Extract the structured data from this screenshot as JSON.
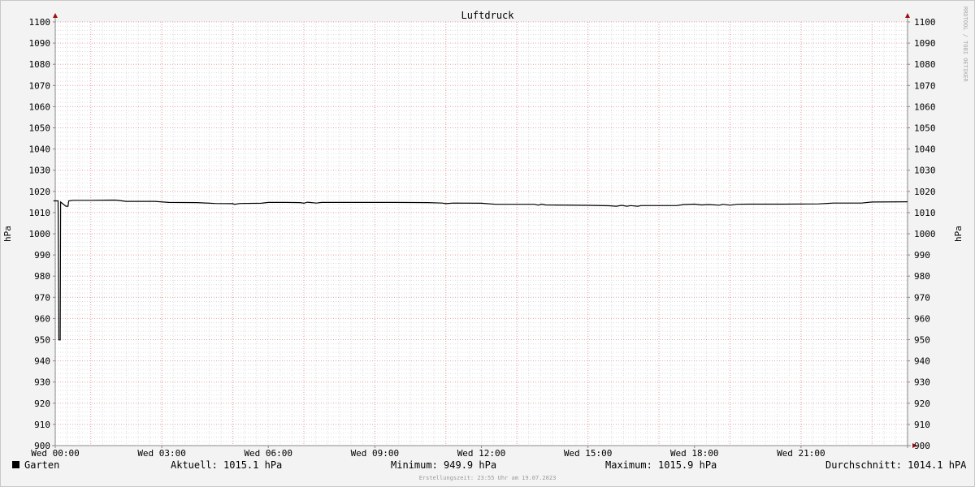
{
  "chart_data": {
    "type": "line",
    "title": "Luftdruck",
    "ylabel_left": "hPa",
    "ylabel_right": "hPa",
    "ylim": [
      900,
      1100
    ],
    "y_ticks": [
      900,
      910,
      920,
      930,
      940,
      950,
      960,
      970,
      980,
      990,
      1000,
      1010,
      1020,
      1030,
      1040,
      1050,
      1060,
      1070,
      1080,
      1090,
      1100
    ],
    "xlim_hours": [
      0,
      24
    ],
    "x_ticks": [
      {
        "hour": 0,
        "label": "Wed 00:00"
      },
      {
        "hour": 3,
        "label": "Wed 03:00"
      },
      {
        "hour": 6,
        "label": "Wed 06:00"
      },
      {
        "hour": 9,
        "label": "Wed 09:00"
      },
      {
        "hour": 12,
        "label": "Wed 12:00"
      },
      {
        "hour": 15,
        "label": "Wed 15:00"
      },
      {
        "hour": 18,
        "label": "Wed 18:00"
      },
      {
        "hour": 21,
        "label": "Wed 21:00"
      }
    ],
    "grid": true,
    "series": [
      {
        "name": "Garten",
        "color": "#000000",
        "points": [
          [
            -0.05,
            1015.5
          ],
          [
            0.08,
            1015.5
          ],
          [
            0.1,
            949.9
          ],
          [
            0.14,
            949.9
          ],
          [
            0.15,
            1015.0
          ],
          [
            0.3,
            1013.0
          ],
          [
            0.36,
            1013.0
          ],
          [
            0.38,
            1015.5
          ],
          [
            0.5,
            1015.8
          ],
          [
            1.0,
            1015.8
          ],
          [
            1.7,
            1015.9
          ],
          [
            2.0,
            1015.3
          ],
          [
            2.8,
            1015.3
          ],
          [
            3.2,
            1014.8
          ],
          [
            4.0,
            1014.7
          ],
          [
            4.5,
            1014.3
          ],
          [
            5.0,
            1014.2
          ],
          [
            5.05,
            1013.9
          ],
          [
            5.2,
            1014.3
          ],
          [
            5.8,
            1014.4
          ],
          [
            6.0,
            1014.8
          ],
          [
            6.5,
            1014.8
          ],
          [
            6.9,
            1014.7
          ],
          [
            7.0,
            1014.4
          ],
          [
            7.1,
            1014.9
          ],
          [
            7.35,
            1014.5
          ],
          [
            7.5,
            1014.8
          ],
          [
            8.5,
            1014.8
          ],
          [
            9.5,
            1014.8
          ],
          [
            10.5,
            1014.7
          ],
          [
            10.9,
            1014.5
          ],
          [
            11.0,
            1014.2
          ],
          [
            11.2,
            1014.5
          ],
          [
            12.0,
            1014.4
          ],
          [
            12.4,
            1013.9
          ],
          [
            13.5,
            1013.9
          ],
          [
            13.6,
            1013.5
          ],
          [
            13.7,
            1014.0
          ],
          [
            13.8,
            1013.6
          ],
          [
            15.0,
            1013.4
          ],
          [
            15.6,
            1013.2
          ],
          [
            15.8,
            1013.0
          ],
          [
            15.95,
            1013.4
          ],
          [
            16.1,
            1013.0
          ],
          [
            16.2,
            1013.3
          ],
          [
            16.4,
            1013.0
          ],
          [
            16.5,
            1013.3
          ],
          [
            17.5,
            1013.3
          ],
          [
            17.7,
            1013.8
          ],
          [
            18.0,
            1014.0
          ],
          [
            18.2,
            1013.6
          ],
          [
            18.4,
            1013.8
          ],
          [
            18.7,
            1013.5
          ],
          [
            18.8,
            1013.9
          ],
          [
            19.0,
            1013.5
          ],
          [
            19.2,
            1013.9
          ],
          [
            19.5,
            1014.0
          ],
          [
            20.5,
            1014.0
          ],
          [
            21.5,
            1014.1
          ],
          [
            21.9,
            1014.5
          ],
          [
            22.7,
            1014.5
          ],
          [
            23.0,
            1015.0
          ],
          [
            24.0,
            1015.1
          ]
        ]
      }
    ],
    "legend": {
      "label": "Garten",
      "aktuell": "Aktuell: 1015.1 hPa",
      "minimum": "Minimum: 949.9 hPa",
      "maximum": "Maximum: 1015.9 hPa",
      "durchschnitt": "Durchschnitt: 1014.1 hPA"
    },
    "footer": "Erstellungszeit: 23:55 Uhr am 19.07.2023",
    "watermark": "RRDTOOL / TOBI OETIKER",
    "colors": {
      "background": "#f3f3f3",
      "plot_background": "#ffffff",
      "major_grid": "#e7a0a0",
      "minor_grid": "#dddddd",
      "line": "#000000",
      "axis_arrow": "#a01010"
    }
  }
}
